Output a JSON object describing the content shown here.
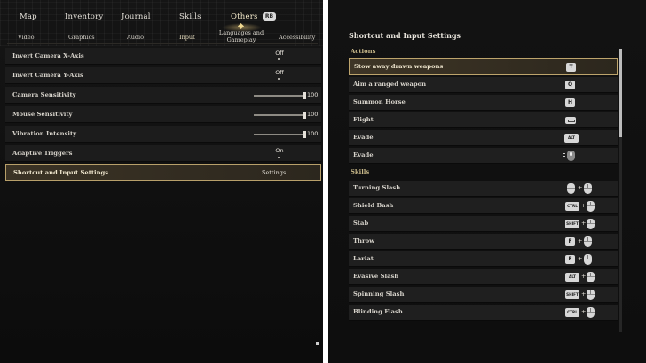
{
  "left": {
    "main_tabs": [
      {
        "label": "Map"
      },
      {
        "label": "Inventory"
      },
      {
        "label": "Journal"
      },
      {
        "label": "Skills"
      },
      {
        "label": "Others"
      }
    ],
    "rb_label": "RB",
    "sub_tabs": [
      {
        "label": "Video"
      },
      {
        "label": "Graphics"
      },
      {
        "label": "Audio"
      },
      {
        "label": "Input"
      },
      {
        "label": "Languages and Gameplay"
      },
      {
        "label": "Accessibility"
      }
    ],
    "active_sub_tab": "Input",
    "settings": [
      {
        "label": "Invert Camera X-Axis",
        "value": "Off"
      },
      {
        "label": "Invert Camera Y-Axis",
        "value": "Off"
      },
      {
        "label": "Camera Sensitivity",
        "value": "100",
        "level": 100
      },
      {
        "label": "Mouse Sensitivity",
        "value": "100",
        "level": 100
      },
      {
        "label": "Vibration Intensity",
        "value": "100",
        "level": 100
      },
      {
        "label": "Adaptive Triggers",
        "value": "On"
      },
      {
        "label": "Shortcut and Input Settings",
        "value": "Settings"
      }
    ]
  },
  "right": {
    "title": "Shortcut and Input Settings",
    "sections": {
      "actions": "Actions",
      "skills": "Skills"
    },
    "actions": [
      {
        "label": "Stow away drawn weapons",
        "key": "T"
      },
      {
        "label": "Aim a ranged weapon",
        "key": "Q"
      },
      {
        "label": "Summon Horse",
        "key": "H"
      },
      {
        "label": "Flight",
        "key": "space-bar-icon"
      },
      {
        "label": "Evade",
        "key": "ALT"
      },
      {
        "label": "Evade",
        "key": "mouse-scroll-icon"
      }
    ],
    "skills": [
      {
        "label": "Turning Slash",
        "key": "mouse",
        "plus": "+"
      },
      {
        "label": "Shield Bash",
        "key": "CTRL",
        "plus": "+"
      },
      {
        "label": "Stab",
        "key": "SHIFT",
        "plus": "+"
      },
      {
        "label": "Throw",
        "key": "F",
        "plus": "+"
      },
      {
        "label": "Lariat",
        "key": "F",
        "plus": "+"
      },
      {
        "label": "Evasive Slash",
        "key": "ALT",
        "plus": "+"
      },
      {
        "label": "Spinning Slash",
        "key": "SHIFT",
        "plus": "+"
      },
      {
        "label": "Blinding Flash",
        "key": "CTRL",
        "plus": "+"
      }
    ]
  }
}
